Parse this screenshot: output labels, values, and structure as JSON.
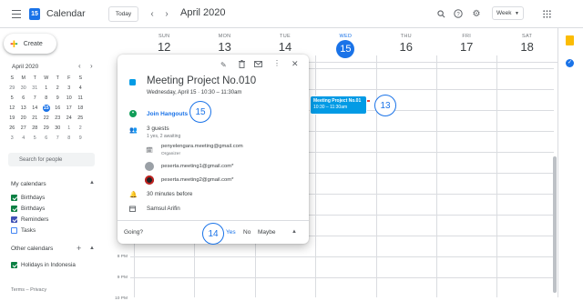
{
  "header": {
    "app_title": "Calendar",
    "logo_text": "15",
    "today_label": "Today",
    "prev_icon": "chevron-left-icon",
    "next_icon": "chevron-right-icon",
    "month_label": "April 2020",
    "view_selector": "Week"
  },
  "sidebar": {
    "create_label": "Create",
    "mini_month": "April 2020",
    "weekday_initials": [
      "S",
      "M",
      "T",
      "W",
      "T",
      "F",
      "S"
    ],
    "mini_days": [
      [
        "29",
        "30",
        "31",
        "1",
        "2",
        "3",
        "4"
      ],
      [
        "5",
        "6",
        "7",
        "8",
        "9",
        "10",
        "11"
      ],
      [
        "12",
        "13",
        "14",
        "15",
        "16",
        "17",
        "18"
      ],
      [
        "19",
        "20",
        "21",
        "22",
        "23",
        "24",
        "25"
      ],
      [
        "26",
        "27",
        "28",
        "29",
        "30",
        "1",
        "2"
      ],
      [
        "3",
        "4",
        "5",
        "6",
        "7",
        "8",
        "9"
      ]
    ],
    "search_people_placeholder": "Search for people",
    "my_calendars_label": "My calendars",
    "my_calendars": [
      {
        "label": "Birthdays",
        "color": "#0b8043",
        "checked": true
      },
      {
        "label": "Birthdays",
        "color": "#0b8043",
        "checked": true
      },
      {
        "label": "Reminders",
        "color": "#3f51b5",
        "checked": true
      },
      {
        "label": "Tasks",
        "color": "#4285f4",
        "checked": false
      }
    ],
    "other_calendars_label": "Other calendars",
    "other_calendars": [
      {
        "label": "Holidays in Indonesia",
        "color": "#0b8043",
        "checked": true
      }
    ],
    "footer": "Terms – Privacy"
  },
  "week": {
    "days": [
      {
        "dow": "SUN",
        "num": "12",
        "today": false
      },
      {
        "dow": "MON",
        "num": "13",
        "today": false
      },
      {
        "dow": "TUE",
        "num": "14",
        "today": false
      },
      {
        "dow": "WED",
        "num": "15",
        "today": true
      },
      {
        "dow": "THU",
        "num": "16",
        "today": false
      },
      {
        "dow": "FRI",
        "num": "17",
        "today": false
      },
      {
        "dow": "SAT",
        "num": "18",
        "today": false
      }
    ],
    "time_labels": [
      "8 PM",
      "9 PM",
      "10 PM"
    ],
    "event_chip": {
      "title": "Meeting Project No.01",
      "time": "10:30 – 11:30am"
    },
    "marker_13": "13"
  },
  "popup": {
    "title": "Meeting Project No.010",
    "datetime": "Wednesday, April 15  ·  10:30 – 11:30am",
    "hangouts_label": "Join Hangouts",
    "marker_15": "15",
    "guests_count": "3 guests",
    "guests_status": "1 yes, 2 awaiting",
    "organizer_email": "penyelengara.meeting@gmail.com",
    "organizer_label": "Organizer",
    "guest1": "peserta.meeting1@gmail.com*",
    "guest2": "peserta.meeting2@gmail.com*",
    "reminder": "30 minutes before",
    "owner": "Samsul Arifin",
    "going_label": "Going?",
    "marker_14": "14",
    "yes_label": "Yes",
    "no_label": "No",
    "maybe_label": "Maybe"
  },
  "colors": {
    "accent": "#1a73e8",
    "event_blue": "#039be5",
    "green": "#0b8043"
  }
}
